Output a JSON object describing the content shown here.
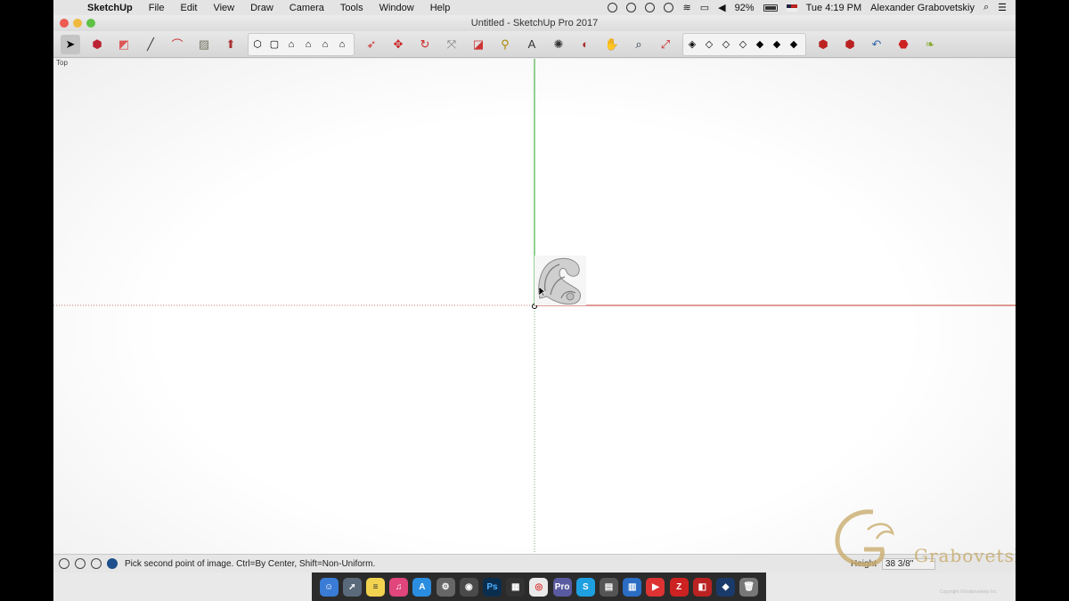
{
  "menubar": {
    "app_name": "SketchUp",
    "menus": [
      "File",
      "Edit",
      "View",
      "Draw",
      "Camera",
      "Tools",
      "Window",
      "Help"
    ],
    "battery": "92%",
    "clock": "Tue 4:19 PM",
    "user": "Alexander Grabovetskiy"
  },
  "window": {
    "title": "Untitled - SketchUp Pro 2017"
  },
  "viewport": {
    "scene_label": "Top"
  },
  "statusbar": {
    "message": "Pick second point of image. Ctrl=By Center, Shift=Non-Uniform.",
    "measure_label": "Height",
    "measure_value": "38 3/8\""
  },
  "watermark": {
    "name": "Grabovetskiy",
    "copyright": "Copyright ©Grabovetskiy Inc"
  },
  "colors": {
    "green_axis": "#2aa12a",
    "red_axis": "#c0392b"
  }
}
